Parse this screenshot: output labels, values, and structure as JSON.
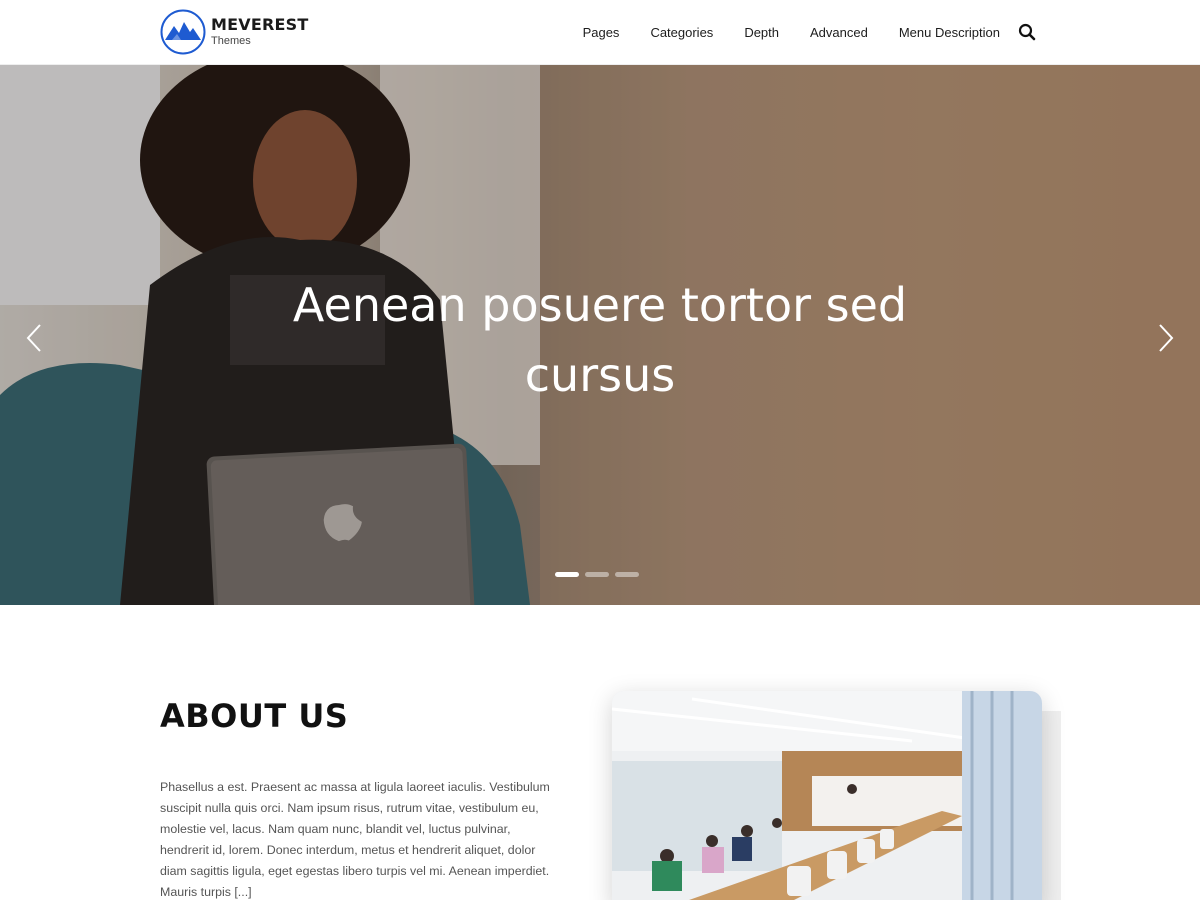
{
  "brand": {
    "name": "MEVEREST",
    "tagline": "Themes",
    "accent": "#1e5bd1"
  },
  "nav": {
    "items": [
      {
        "label": "Pages"
      },
      {
        "label": "Categories"
      },
      {
        "label": "Depth"
      },
      {
        "label": "Advanced"
      },
      {
        "label": "Menu Description"
      }
    ],
    "search_icon": "search-icon"
  },
  "hero": {
    "title": "Aenean posuere tortor sed cursus",
    "slides": 3,
    "active_slide": 1,
    "prev_icon": "chevron-left-icon",
    "next_icon": "chevron-right-icon"
  },
  "about": {
    "title": "ABOUT US",
    "text": "Phasellus a est. Praesent ac massa at ligula laoreet iaculis. Vestibulum suscipit nulla quis orci. Nam ipsum risus, rutrum vitae, vestibulum eu, molestie vel, lacus. Nam quam nunc, blandit vel, luctus pulvinar, hendrerit id, lorem. Donec interdum, metus et hendrerit aliquet, dolor diam sagittis ligula, eget egestas libero turpis vel mi. Aenean imperdiet. Mauris turpis [...]"
  }
}
